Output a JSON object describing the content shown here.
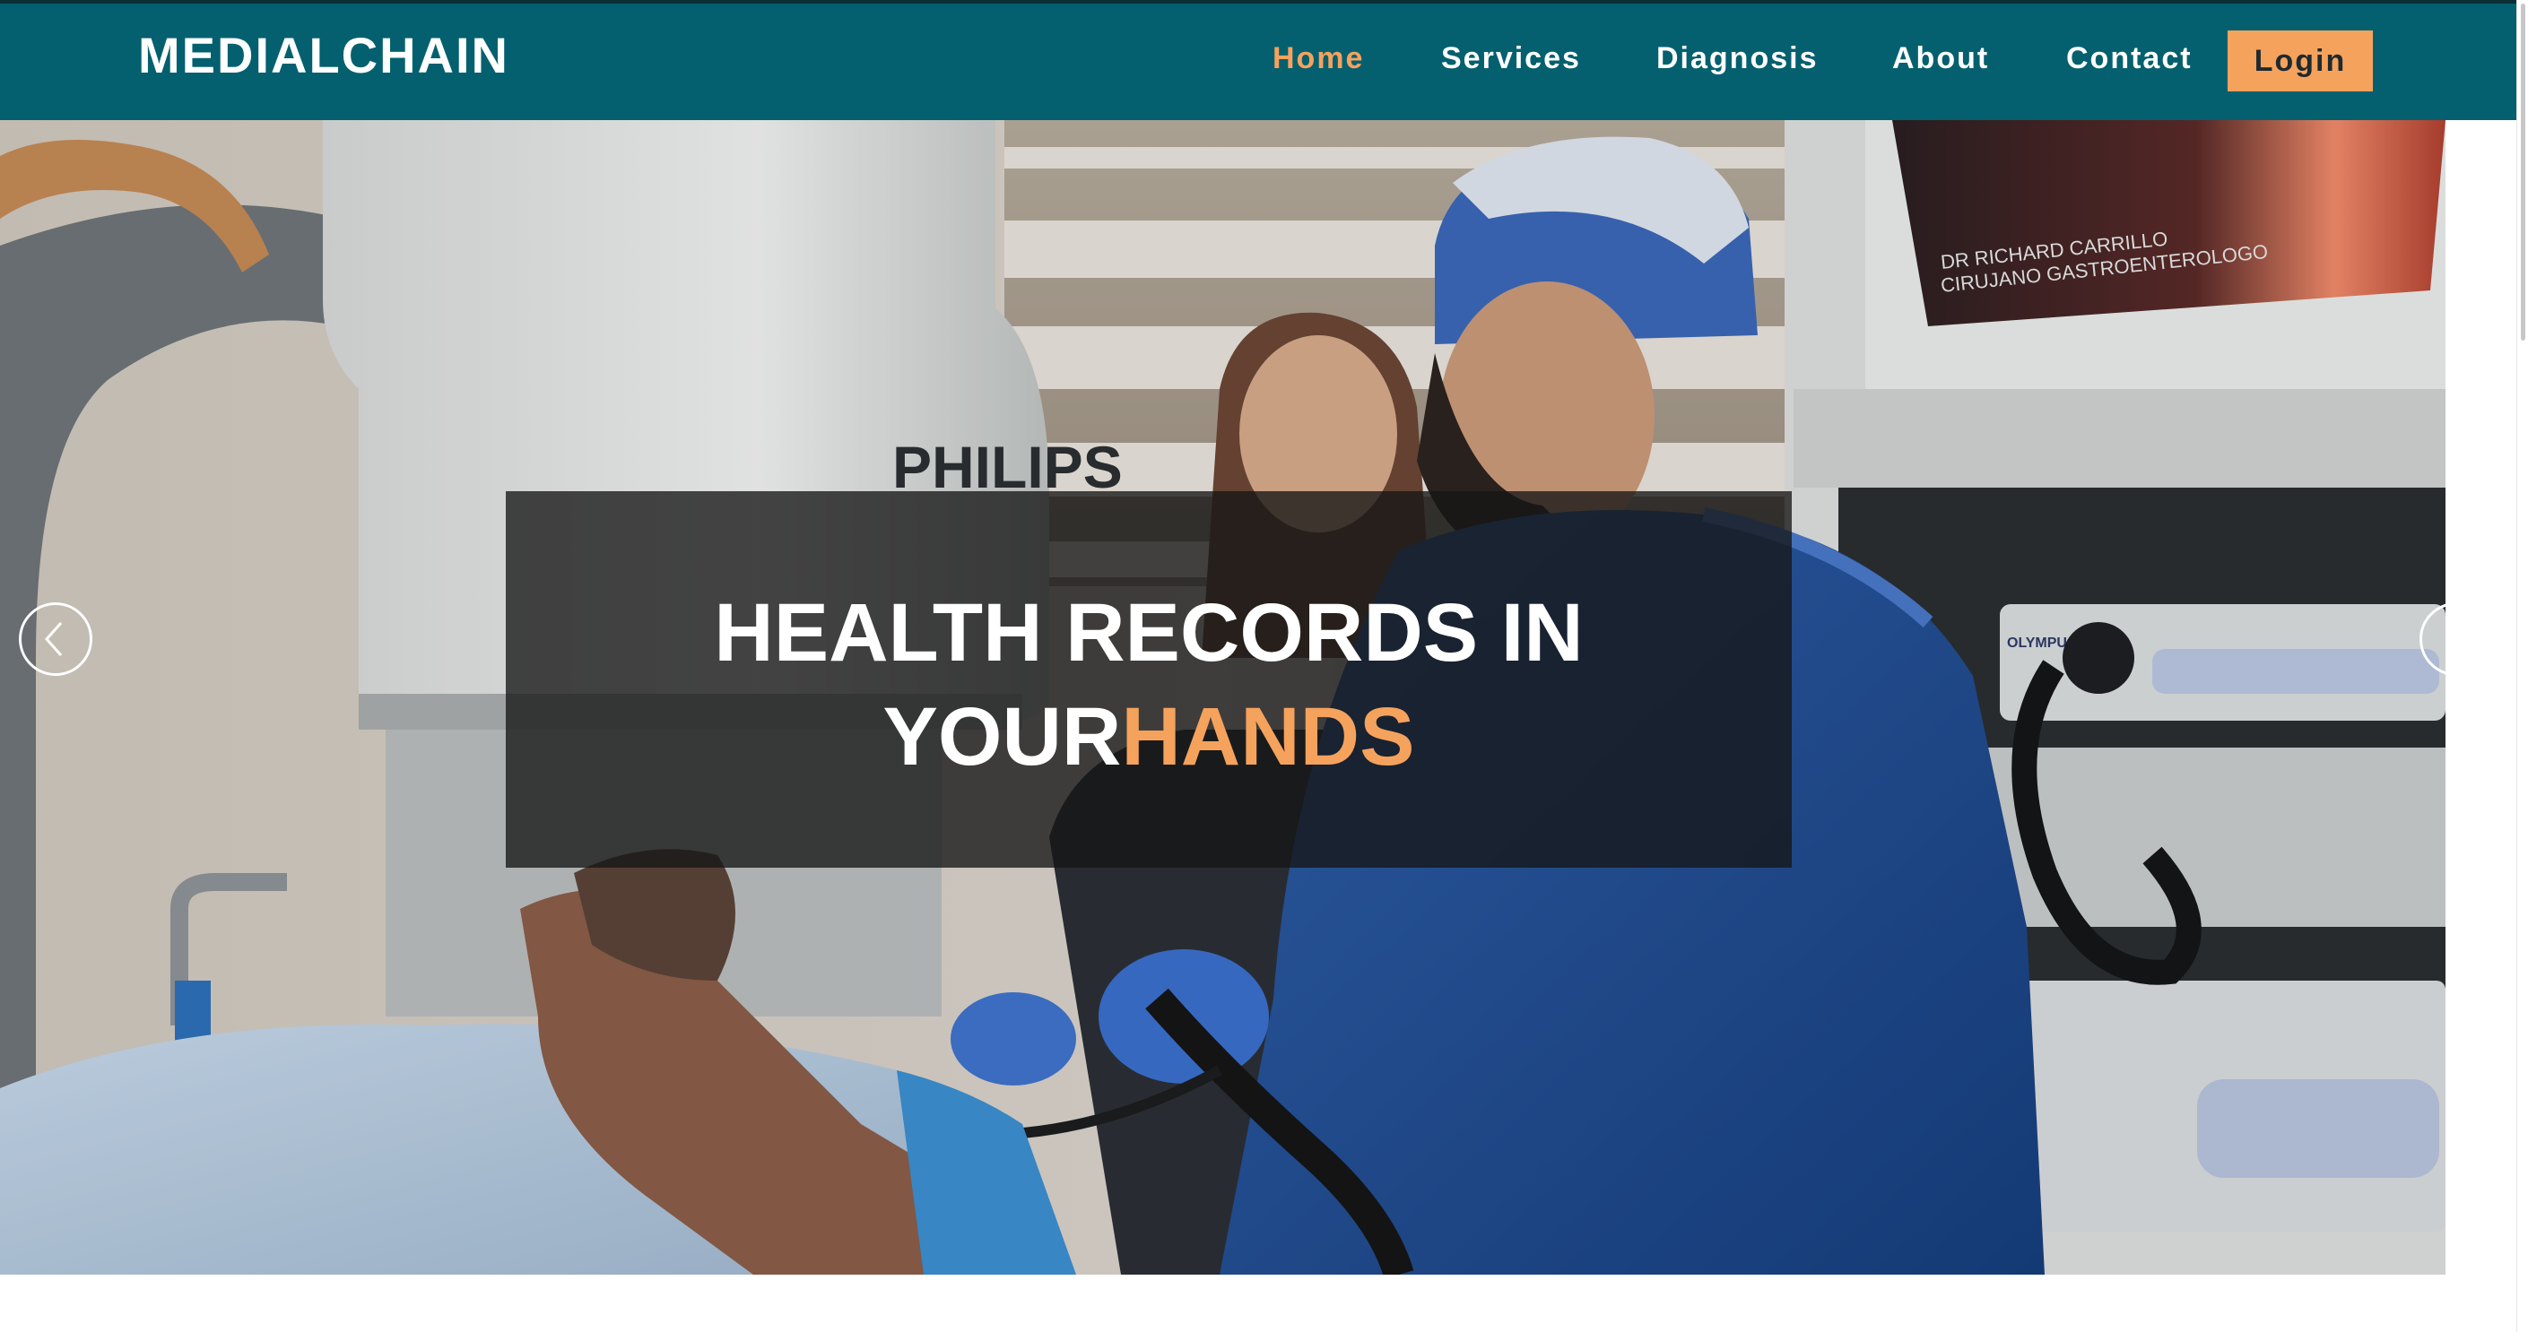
{
  "brand": "MEDIALCHAIN",
  "nav": {
    "links": [
      "Home",
      "Services",
      "Diagnosis",
      "About",
      "Contact"
    ],
    "active": "Home",
    "login_label": "Login"
  },
  "hero": {
    "image_description": "Operating room photo: a surgeon in blue scrubs and surgical cap holds an endoscope beside a nurse and a patient lying on a bed; a PHILIPS imaging machine on the left and OLYMPUS equipment with a monitor on the right.",
    "monitor_text_line1": "DR RICHARD CARRILLO",
    "monitor_text_line2": "CIRUJANO GASTROENTEROLOGO",
    "machine_brand": "PHILIPS",
    "equipment_brand": "OLYMPUS",
    "headline_line1": "HEALTH RECORDS IN",
    "headline_line2_white": "YOUR",
    "headline_line2_accent": "HANDS",
    "prev_icon": "chevron-left-icon",
    "next_icon": "chevron-right-icon"
  },
  "colors": {
    "navbar": "#04606f",
    "accent": "#f5a25d",
    "overlay": "#161616"
  }
}
